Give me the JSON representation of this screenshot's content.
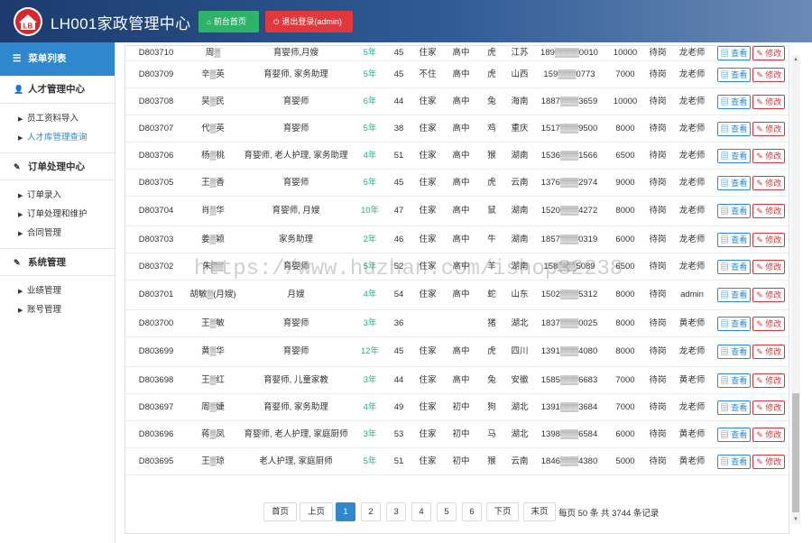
{
  "header": {
    "title": "LH001家政管理中心",
    "home_label": "前台首页",
    "logout_label": "退出登录(admin)"
  },
  "sidebar": {
    "menu_title": "菜单列表",
    "sections": [
      {
        "label": "人才管理中心",
        "items": [
          {
            "label": "员工资料导入",
            "active": false
          },
          {
            "label": "人才库管理查询",
            "active": true
          }
        ]
      },
      {
        "label": "订单处理中心",
        "items": [
          {
            "label": "订单录入",
            "active": false
          },
          {
            "label": "订单处理和维护",
            "active": false
          },
          {
            "label": "合同管理",
            "active": false
          }
        ]
      },
      {
        "label": "系统管理",
        "items": [
          {
            "label": "业绩管理",
            "active": false
          },
          {
            "label": "账号管理",
            "active": false
          }
        ]
      }
    ]
  },
  "table": {
    "partial_first_row": [
      "D803710",
      "周▒",
      "育婴师,月嫂",
      "5年",
      "45",
      "住家",
      "高中",
      "虎",
      "江苏",
      "189▒▒▒▒0010",
      "10000",
      "待岗",
      "龙老师"
    ],
    "rows": [
      [
        "D803709",
        "辛▒英",
        "育婴师, 家务助理",
        "5年",
        "45",
        "不住",
        "高中",
        "虎",
        "山西",
        "159▒▒▒0773",
        "7000",
        "待岗",
        "龙老师"
      ],
      [
        "D803708",
        "吴▒民",
        "育婴师",
        "6年",
        "44",
        "住家",
        "高中",
        "兔",
        "海南",
        "1887▒▒▒3659",
        "10000",
        "待岗",
        "龙老师"
      ],
      [
        "D803707",
        "代▒英",
        "育婴师",
        "5年",
        "38",
        "住家",
        "高中",
        "鸡",
        "重庆",
        "1517▒▒▒9500",
        "8000",
        "待岗",
        "龙老师"
      ],
      [
        "D803706",
        "杨▒桃",
        "育婴师, 老人护理, 家务助理",
        "4年",
        "51",
        "住家",
        "高中",
        "猴",
        "湖南",
        "1536▒▒▒1566",
        "6500",
        "待岗",
        "龙老师"
      ],
      [
        "D803705",
        "王▒香",
        "育婴师",
        "5年",
        "45",
        "住家",
        "高中",
        "虎",
        "云南",
        "1376▒▒▒2974",
        "9000",
        "待岗",
        "龙老师"
      ],
      [
        "D803704",
        "肖▒华",
        "育婴师, 月嫂",
        "10年",
        "47",
        "住家",
        "高中",
        "鼠",
        "湖南",
        "1520▒▒▒4272",
        "8000",
        "待岗",
        "龙老师"
      ],
      [
        "D803703",
        "姜▒颖",
        "家务助理",
        "2年",
        "46",
        "住家",
        "高中",
        "牛",
        "湖南",
        "1857▒▒▒0319",
        "6000",
        "待岗",
        "龙老师"
      ],
      [
        "D803702",
        "朱▒▒",
        "育婴师",
        "5年",
        "52",
        "住家",
        "高中",
        "羊",
        "湖南",
        "158▒▒▒5089",
        "6500",
        "待岗",
        "龙老师"
      ],
      [
        "D803701",
        "胡敏▒(月嫂)",
        "月嫂",
        "4年",
        "54",
        "住家",
        "高中",
        "蛇",
        "山东",
        "1502▒▒▒5312",
        "8000",
        "待岗",
        "admin"
      ],
      [
        "D803700",
        "王▒敏",
        "育婴师",
        "3年",
        "36",
        "",
        "",
        "猪",
        "湖北",
        "1837▒▒▒0025",
        "8000",
        "待岗",
        "黄老师"
      ],
      [
        "D803699",
        "黄▒华",
        "育婴师",
        "12年",
        "45",
        "住家",
        "高中",
        "虎",
        "四川",
        "1391▒▒▒4080",
        "8000",
        "待岗",
        "龙老师"
      ],
      [
        "D803698",
        "王▒红",
        "育婴师, 儿童家教",
        "3年",
        "44",
        "住家",
        "高中",
        "兔",
        "安徽",
        "1585▒▒▒6683",
        "7000",
        "待岗",
        "黄老师"
      ],
      [
        "D803697",
        "周▒婕",
        "育婴师, 家务助理",
        "4年",
        "49",
        "住家",
        "初中",
        "狗",
        "湖北",
        "1391▒▒▒3684",
        "7000",
        "待岗",
        "龙老师"
      ],
      [
        "D803696",
        "蒋▒凤",
        "育婴师, 老人护理, 家庭厨师",
        "3年",
        "53",
        "住家",
        "初中",
        "马",
        "湖北",
        "1398▒▒▒6584",
        "6000",
        "待岗",
        "黄老师"
      ],
      [
        "D803695",
        "王▒琼",
        "老人护理, 家庭厨师",
        "5年",
        "51",
        "住家",
        "初中",
        "猴",
        "云南",
        "1846▒▒▒4380",
        "5000",
        "待岗",
        "黄老师"
      ]
    ],
    "view_label": "查看",
    "edit_label": "修改"
  },
  "pagination": {
    "first": "首页",
    "prev": "上页",
    "pages": [
      "1",
      "2",
      "3",
      "4",
      "5",
      "6"
    ],
    "current": "1",
    "next": "下页",
    "last": "末页",
    "info": "每页 50 条 共 3744 条记录"
  },
  "watermark": "https://www.huzhan.com/ishop32238",
  "colors": {
    "primary": "#2e87cf",
    "success": "#2fb36b",
    "danger": "#e0383d",
    "experience": "#27ae8a"
  }
}
